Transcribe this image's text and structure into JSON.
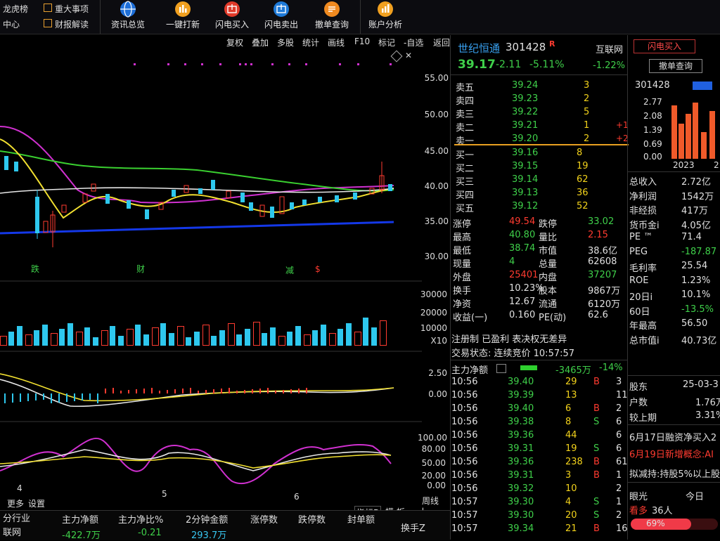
{
  "toolbar": {
    "left_top": "龙虎榜",
    "left_bottom": "中心",
    "item2_top": "重大事项",
    "item2_bottom": "财报解读",
    "buttons": [
      "资讯总览",
      "一键打新",
      "闪电买入",
      "闪电卖出",
      "撤单查询",
      "账户分析"
    ]
  },
  "chart_tools": [
    "复权",
    "叠加",
    "多股",
    "统计",
    "画线",
    "F10",
    "标记",
    "-自选",
    "返回"
  ],
  "price_axis": [
    "55.00",
    "50.00",
    "45.00",
    "40.00",
    "35.00",
    "30.00"
  ],
  "volume_axis": [
    "30000",
    "20000",
    "10000",
    "X10"
  ],
  "macd_axis": [
    "2.50",
    "0.00"
  ],
  "kdj_axis": [
    "100.00",
    "80.00",
    "50.00",
    "20.00",
    "0.00"
  ],
  "event_marks": [
    "跌",
    "财",
    "减",
    "$"
  ],
  "date_labels": [
    "4",
    "5",
    "6"
  ],
  "bottom_left": [
    "更多",
    "设置"
  ],
  "bottom_controls": {
    "indicator": "指标B",
    "template": "模 板",
    "plus": "+",
    "minus": "-",
    "weekly": "周线"
  },
  "stock": {
    "name": "世纪恒通",
    "code": "301428",
    "flag": "R",
    "tag": "互联网",
    "tag_change": "-1.22%",
    "price": "39.17",
    "change": "-2.11",
    "change_pct": "-5.11%"
  },
  "order_book": {
    "sell": [
      {
        "label": "卖五",
        "price": "39.24",
        "vol": "3",
        "delta": ""
      },
      {
        "label": "卖四",
        "price": "39.23",
        "vol": "2",
        "delta": ""
      },
      {
        "label": "卖三",
        "price": "39.22",
        "vol": "5",
        "delta": ""
      },
      {
        "label": "卖二",
        "price": "39.21",
        "vol": "1",
        "delta": "+1"
      },
      {
        "label": "卖一",
        "price": "39.20",
        "vol": "2",
        "delta": "+2"
      }
    ],
    "buy": [
      {
        "label": "买一",
        "price": "39.16",
        "vol": "8"
      },
      {
        "label": "买二",
        "price": "39.15",
        "vol": "19"
      },
      {
        "label": "买三",
        "price": "39.14",
        "vol": "62"
      },
      {
        "label": "买四",
        "price": "39.13",
        "vol": "36"
      },
      {
        "label": "买五",
        "price": "39.12",
        "vol": "52"
      }
    ]
  },
  "stats": {
    "zt_label": "涨停",
    "zt": "49.54",
    "dt_label": "跌停",
    "dt": "33.02",
    "high_label": "最高",
    "high": "40.80",
    "lb_label": "量比",
    "lb": "2.15",
    "low_label": "最低",
    "low": "38.74",
    "mv_label": "市值",
    "mv": "38.6亿",
    "now_label": "现量",
    "now": "4",
    "tot_label": "总量",
    "tot": "62608",
    "out_label": "外盘",
    "out": "25401",
    "in_label": "内盘",
    "in": "37207",
    "hs_label": "换手",
    "hs": "10.23%",
    "gb_label": "股本",
    "gb": "9867万",
    "jz_label": "净资",
    "jz": "12.67",
    "lt_label": "流通",
    "lt": "6120万",
    "sy_label": "收益(一)",
    "sy": "0.160",
    "pe_label": "PE(动)",
    "pe": "62.6"
  },
  "status": {
    "line1": "注册制 已盈利 表决权无差异",
    "line2": "交易状态: 连续竞价 10:57:57"
  },
  "net_flow": {
    "label": "主力净额",
    "value": "-3465万",
    "pct": "-14%"
  },
  "ticks": [
    {
      "t": "10:56",
      "p": "39.40",
      "v": "29",
      "s": "B",
      "e": "3"
    },
    {
      "t": "10:56",
      "p": "39.39",
      "v": "13",
      "s": "",
      "e": "11"
    },
    {
      "t": "10:56",
      "p": "39.40",
      "v": "6",
      "s": "B",
      "e": "2"
    },
    {
      "t": "10:56",
      "p": "39.38",
      "v": "8",
      "s": "S",
      "e": "6"
    },
    {
      "t": "10:56",
      "p": "39.36",
      "v": "44",
      "s": "",
      "e": "6"
    },
    {
      "t": "10:56",
      "p": "39.31",
      "v": "19",
      "s": "S",
      "e": "6"
    },
    {
      "t": "10:56",
      "p": "39.36",
      "v": "238",
      "s": "B",
      "e": "61"
    },
    {
      "t": "10:56",
      "p": "39.31",
      "v": "3",
      "s": "B",
      "e": "1"
    },
    {
      "t": "10:56",
      "p": "39.32",
      "v": "10",
      "s": "",
      "e": "2"
    },
    {
      "t": "10:57",
      "p": "39.30",
      "v": "4",
      "s": "S",
      "e": "1"
    },
    {
      "t": "10:57",
      "p": "39.30",
      "v": "20",
      "s": "S",
      "e": "2"
    },
    {
      "t": "10:57",
      "p": "39.34",
      "v": "21",
      "s": "B",
      "e": "16"
    }
  ],
  "right": {
    "btn_buy": "闪电买入",
    "btn_cancel": "撤单查询",
    "code": "301428",
    "bar_axis": [
      "2.77",
      "2.08",
      "1.39",
      "0.69",
      "0.00"
    ],
    "year": "2023",
    "year2": "2",
    "fin": [
      {
        "k": "总收入",
        "v": "2.72亿"
      },
      {
        "k": "净利润",
        "v": "1542万"
      },
      {
        "k": "非经损",
        "v": "417万"
      },
      {
        "k": "货币金ⅰ",
        "v": "4.05亿"
      },
      {
        "k": "PE ™",
        "v": "71.4"
      },
      {
        "k": "PEG",
        "v": "-187.87"
      },
      {
        "k": "毛利率",
        "v": "25.54"
      },
      {
        "k": "ROE",
        "v": "1.23%"
      },
      {
        "k": "20日ⅰ",
        "v": "10.1%"
      },
      {
        "k": "60日",
        "v": "-13.5%"
      },
      {
        "k": "年最高",
        "v": "56.50"
      },
      {
        "k": "总市值ⅰ",
        "v": "40.73亿"
      }
    ],
    "holder_label": "股东",
    "holder_date": "25-03-3",
    "hs_label": "户数",
    "hs": "1.76万",
    "cmp_label": "较上期",
    "cmp": "3.31%",
    "news1": "6月17日融资净买入2",
    "news2": "6月19日新增概念:AI",
    "news3": "拟减持:持股5%以上股",
    "vision_label": "眼光",
    "vision_today": "今日",
    "bear_label": "看多",
    "bear_count": "36人",
    "bull_pct": "69%"
  },
  "bottom_stats": {
    "headers": [
      "主力净额",
      "主力净比%",
      "2分钟金额",
      "涨停数",
      "跌停数",
      "封单额",
      "换手Z"
    ],
    "values": [
      "-422.7万",
      "-0.21",
      "293.7万"
    ],
    "left_rows": [
      "分行业",
      "联网"
    ]
  }
}
